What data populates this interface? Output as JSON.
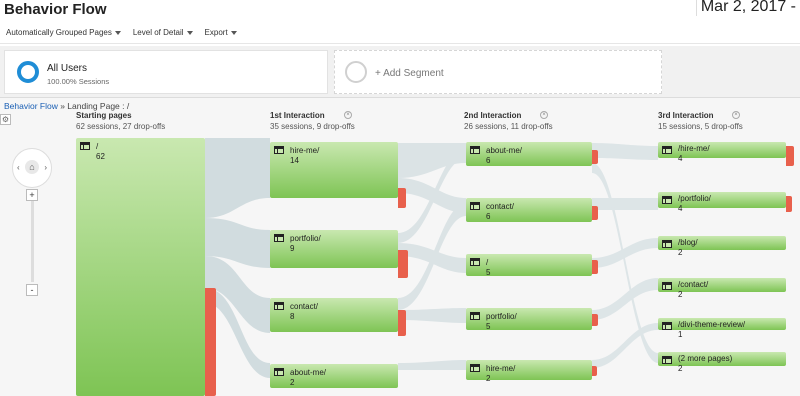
{
  "header": {
    "title": "Behavior Flow",
    "date": "Mar 2, 2017 -"
  },
  "toolbar": {
    "grouping": "Automatically Grouped Pages",
    "detail": "Level of Detail",
    "export": "Export"
  },
  "segments": {
    "primary_name": "All Users",
    "primary_sub": "100.00% Sessions",
    "add": "+ Add Segment"
  },
  "breadcrumb": {
    "link": "Behavior Flow",
    "rest": " » Landing Page : /"
  },
  "columns": [
    {
      "title": "Starting pages",
      "stats": "62 sessions, 27 drop-offs"
    },
    {
      "title": "1st Interaction",
      "stats": "35 sessions, 9 drop-offs"
    },
    {
      "title": "2nd Interaction",
      "stats": "26 sessions, 11 drop-offs"
    },
    {
      "title": "3rd Interaction",
      "stats": "15 sessions, 5 drop-offs"
    }
  ],
  "nodes": {
    "start": [
      {
        "name": "/",
        "count": "62"
      }
    ],
    "first": [
      {
        "name": "hire-me/",
        "count": "14"
      },
      {
        "name": "portfolio/",
        "count": "9"
      },
      {
        "name": "contact/",
        "count": "8"
      },
      {
        "name": "about-me/",
        "count": "2"
      }
    ],
    "second": [
      {
        "name": "about-me/",
        "count": "6"
      },
      {
        "name": "contact/",
        "count": "6"
      },
      {
        "name": "/",
        "count": "5"
      },
      {
        "name": "portfolio/",
        "count": "5"
      },
      {
        "name": "hire-me/",
        "count": "2"
      }
    ],
    "third": [
      {
        "name": "/hire-me/",
        "count": "4"
      },
      {
        "name": "/portfolio/",
        "count": "4"
      },
      {
        "name": "/blog/",
        "count": "2"
      },
      {
        "name": "/contact/",
        "count": "2"
      },
      {
        "name": "/divi-theme-review/",
        "count": "1"
      },
      {
        "name": "(2 more pages)",
        "count": "2"
      }
    ]
  },
  "zoom": {
    "plus": "+",
    "minus": "-"
  },
  "colors": {
    "node_top": "#c9e8b0",
    "node_bottom": "#7ec454",
    "dropoff": "#e8604c",
    "link": "#c9d6d9",
    "segment_ring": "#1f8dd6"
  }
}
